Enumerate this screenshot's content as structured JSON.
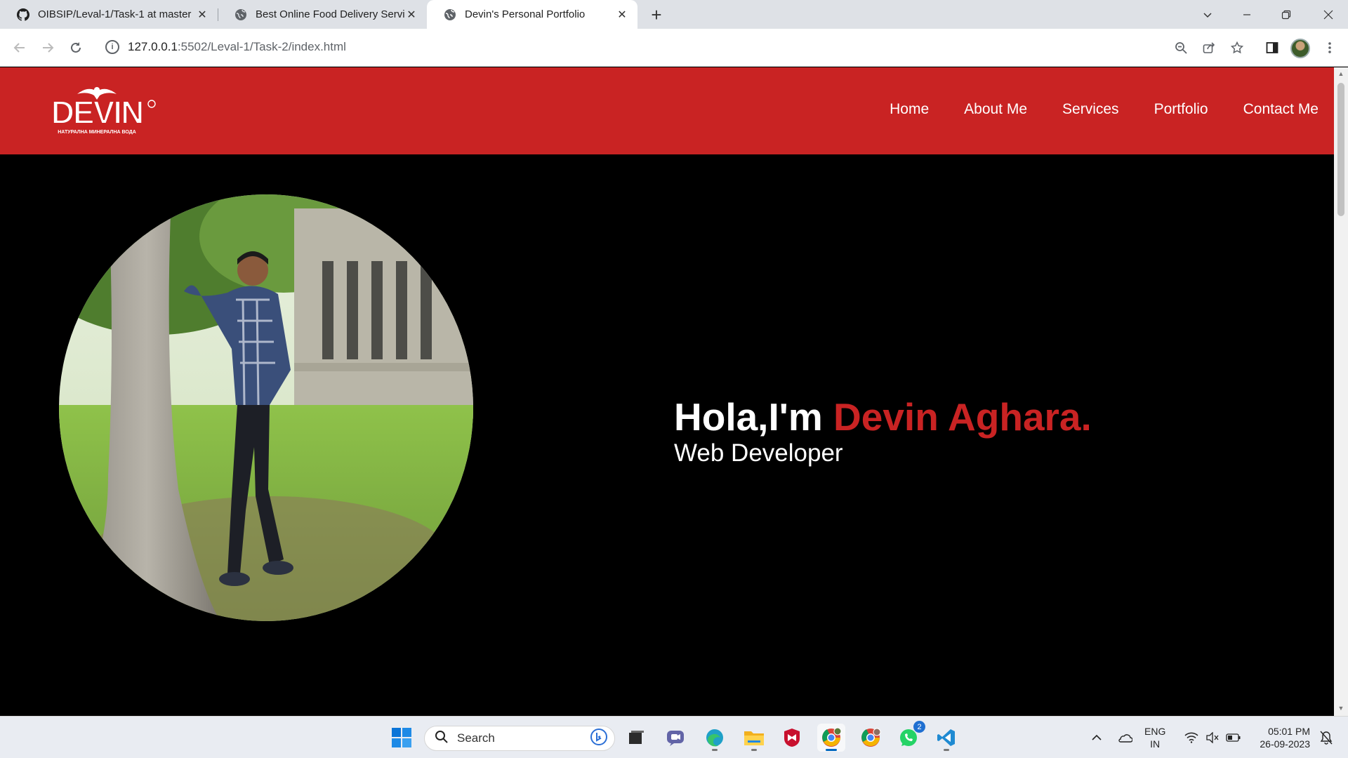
{
  "browser": {
    "tabs": [
      {
        "title": "OIBSIP/Leval-1/Task-1 at master",
        "favicon": "github-icon",
        "active": false
      },
      {
        "title": "Best Online Food Delivery Servic",
        "favicon": "globe-icon",
        "active": false
      },
      {
        "title": "Devin's Personal Portfolio",
        "favicon": "globe-icon",
        "active": true
      }
    ],
    "address": {
      "host": "127.0.0.1",
      "path": ":5502/Leval-1/Task-2/index.html"
    }
  },
  "site": {
    "logo": {
      "text": "DEVIN",
      "tagline": "НАТУРАЛНА МИНЕРАЛНА ВОДА"
    },
    "nav": [
      "Home",
      "About Me",
      "Services",
      "Portfolio",
      "Contact Me"
    ],
    "hero": {
      "greeting": "Hola,I'm ",
      "name": "Devin Aghara.",
      "subtitle": "Web Developer"
    },
    "colors": {
      "brand_red": "#c92323",
      "background": "#000000",
      "text": "#ffffff"
    }
  },
  "taskbar": {
    "search_label": "Search",
    "apps": [
      "windows-start",
      "task-view",
      "teams-chat",
      "edge",
      "file-explorer",
      "mcafee",
      "chrome",
      "chrome-profile",
      "whatsapp",
      "vscode"
    ],
    "whatsapp_badge": "2",
    "language": {
      "line1": "ENG",
      "line2": "IN"
    },
    "time": "05:01 PM",
    "date": "26-09-2023"
  }
}
